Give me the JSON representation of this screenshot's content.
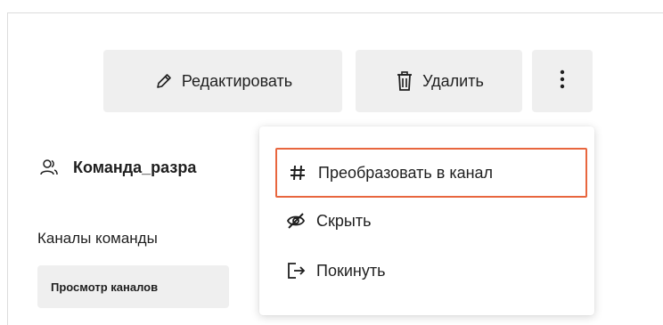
{
  "toolbar": {
    "edit_label": "Редактировать",
    "delete_label": "Удалить",
    "more_icon": "more-vertical-icon",
    "edit_icon": "pencil-icon",
    "delete_icon": "trash-icon"
  },
  "team": {
    "name": "Команда_разра",
    "icon": "users-icon"
  },
  "channels": {
    "section_label": "Каналы команды",
    "view_button_label": "Просмотр каналов"
  },
  "context_menu": {
    "items": [
      {
        "label": "Преобразовать в канал",
        "icon": "hash-icon",
        "highlighted": true
      },
      {
        "label": "Скрыть",
        "icon": "eye-off-icon"
      },
      {
        "label": "Покинуть",
        "icon": "exit-icon"
      }
    ]
  },
  "colors": {
    "highlight_border": "#e8663e",
    "button_bg": "#efefef"
  }
}
